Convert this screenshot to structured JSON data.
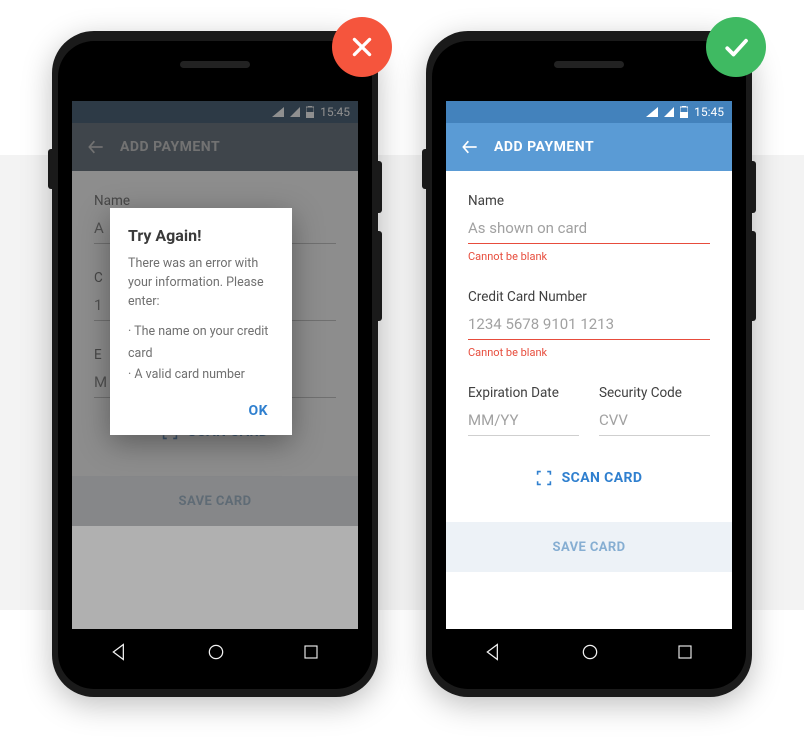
{
  "statusbar": {
    "time": "15:45"
  },
  "appbar": {
    "title": "ADD PAYMENT"
  },
  "fields": {
    "name": {
      "label": "Name",
      "placeholder": "As shown on card",
      "error": "Cannot be blank"
    },
    "card": {
      "label": "Credit Card Number",
      "placeholder": "1234 5678 9101 1213",
      "error": "Cannot be blank"
    },
    "exp": {
      "label": "Expiration Date",
      "placeholder": "MM/YY"
    },
    "cvv": {
      "label": "Security Code",
      "placeholder": "CVV"
    }
  },
  "left_values": {
    "name_val": "A",
    "card_val": "1",
    "exp_label_abbrev": "E",
    "exp_val": "M"
  },
  "buttons": {
    "scan": "SCAN CARD",
    "save": "SAVE CARD"
  },
  "modal": {
    "title": "Try Again!",
    "body": "There was an error with your information. Please enter:",
    "item1": "The name on your credit card",
    "item2": "A valid card number",
    "ok": "OK"
  },
  "labels": {
    "card_abbrev": "C"
  }
}
